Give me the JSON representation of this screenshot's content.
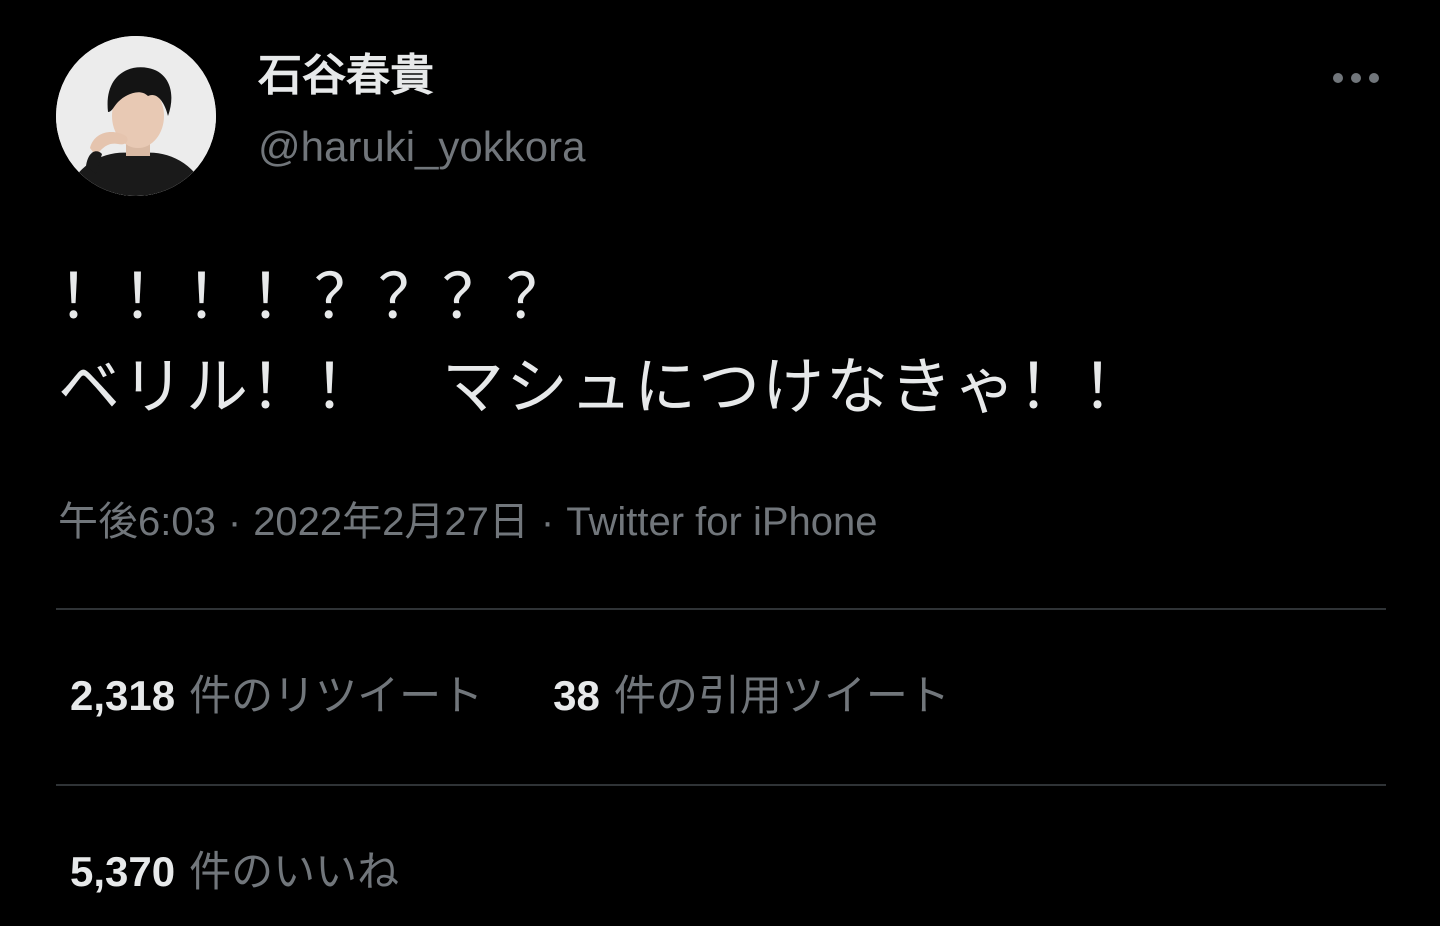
{
  "author": {
    "display_name": "石谷春貴",
    "handle": "@haruki_yokkora"
  },
  "tweet": {
    "text": "！！！！？？？？\nベリル！！　マシュにつけなきゃ！！",
    "time": "午後6:03",
    "date": "2022年2月27日",
    "separator": "·",
    "source": "Twitter for iPhone"
  },
  "stats": {
    "retweets_count": "2,318",
    "retweets_label": "件のリツイート",
    "quotes_count": "38",
    "quotes_label": "件の引用ツイート",
    "likes_count": "5,370",
    "likes_label": "件のいいね"
  },
  "icons": {
    "more": "more-horizontal-icon"
  },
  "colors": {
    "background": "#000000",
    "text_primary": "#e7e9ea",
    "text_secondary": "#71767b",
    "divider": "#2f3336"
  }
}
